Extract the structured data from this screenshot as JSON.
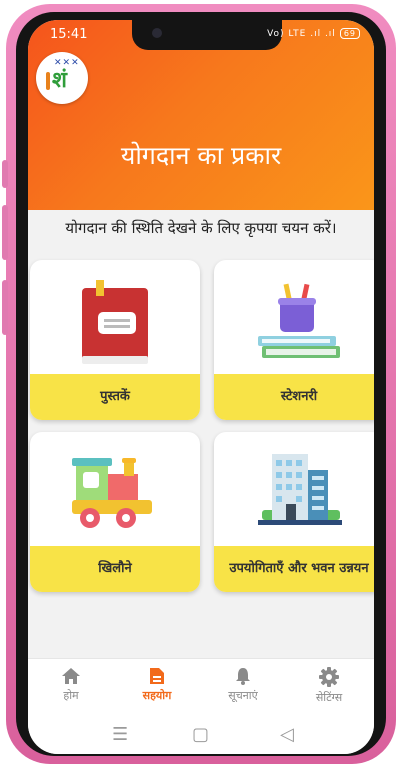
{
  "status": {
    "time": "15:41",
    "signal": "Vo) LTE .ıl .ıl",
    "battery": "69"
  },
  "header": {
    "title": "योगदान का प्रकार"
  },
  "subtitle": "योगदान की स्थिति देखने के लिए कृपया चयन करें।",
  "cards": [
    {
      "label": "पुस्तकें",
      "icon": "book-icon"
    },
    {
      "label": "स्टेशनरी",
      "icon": "stationery-icon"
    },
    {
      "label": "खिलौने",
      "icon": "toy-train-icon"
    },
    {
      "label": "उपयोगिताएँ और भवन उन्नयन",
      "icon": "building-icon"
    }
  ],
  "nav": [
    {
      "label": "होम",
      "icon": "home-icon",
      "active": false
    },
    {
      "label": "सहयोग",
      "icon": "document-icon",
      "active": true
    },
    {
      "label": "सूचनाएं",
      "icon": "bell-icon",
      "active": false
    },
    {
      "label": "सेटिंग्स",
      "icon": "gear-icon",
      "active": false
    }
  ],
  "system_nav": {
    "menu": "☰",
    "home": "▢",
    "back": "◁"
  },
  "colors": {
    "header_start": "#f5541c",
    "header_end": "#fa961a",
    "card_label": "#f8e347",
    "active_nav": "#f26a1b"
  }
}
